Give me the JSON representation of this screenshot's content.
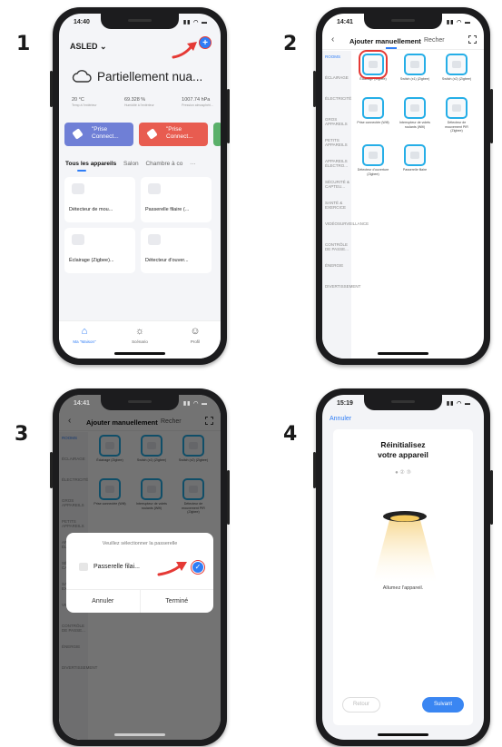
{
  "steps": [
    "1",
    "2",
    "3",
    "4"
  ],
  "phone1": {
    "time": "14:40",
    "signal": "▮▮ ◠ ▬",
    "home_name": "ASLED ⌄",
    "add_symbol": "+",
    "weather_text": "Partiellement nua...",
    "stats": [
      {
        "value": "20 °C",
        "label": "Temp à l'extérieur"
      },
      {
        "value": "69.328 %",
        "label": "Humidité à l'extérieur"
      },
      {
        "value": "1007.74 hPa",
        "label": "Pression atmosphéri..."
      }
    ],
    "scenes": [
      {
        "label": "\"Prise Connect...",
        "color": "#6f7fd6"
      },
      {
        "label": "\"Prise Connect...",
        "color": "#e85c50"
      }
    ],
    "tabs": [
      "Tous les appareils",
      "Salon",
      "Chambre à co",
      "···"
    ],
    "devices": [
      "Détecteur de mou...",
      "Passerelle filaire (...",
      "Éclairage (Zigbee)...",
      "Détecteur d'ouver..."
    ],
    "nav": [
      {
        "icon": "⌂",
        "label": "Ma \"Maison\""
      },
      {
        "icon": "☼",
        "label": "Scénario"
      },
      {
        "icon": "☺",
        "label": "Profil"
      }
    ]
  },
  "phone2": {
    "time": "14:41",
    "back": "‹",
    "title_manual": "Ajouter manuellement",
    "title_search": "Recher",
    "categories": [
      "ROOMS",
      "ÉCLAIRAGE",
      "ÉLECTRICITÉ",
      "GROS APPAREILS",
      "PETITS APPAREILS",
      "APPAREILS ÉLECTRO...",
      "SÉCURITÉ & CAPTEU...",
      "SANTÉ & EXERCICE",
      "VIDÉOSURVEILLANCE",
      "CONTRÔLE DE PASSE...",
      "ÉNERGIE",
      "DIVERTISSEMENT"
    ],
    "devices": [
      "Éclairage (Zigbee)",
      "Switch (x1) (Zigbee)",
      "Switch (x2) (Zigbee)",
      "Prise connectée (Wifi)",
      "Interrupteur de volets roulants (Wifi)",
      "Détecteur de mouvement PIR (Zigbee)",
      "Détecteur d'ouverture (Zigbee)",
      "Passerelle filaire"
    ]
  },
  "phone3": {
    "time": "14:41",
    "dialog_title": "Veuillez sélectionner la passerelle",
    "gateway_name": "Passerelle filai...",
    "check": "✓",
    "cancel": "Annuler",
    "done": "Terminé"
  },
  "phone4": {
    "time": "15:19",
    "cancel": "Annuler",
    "title_line1": "Réinitialisez",
    "title_line2": "votre appareil",
    "progress": "● ② ③",
    "message": "Allumez l'appareil.",
    "back": "Retour",
    "next": "Suivant"
  },
  "colors": {
    "accent": "#2f7df6",
    "highlight_red": "#e53935",
    "device_border": "#25aee7"
  }
}
